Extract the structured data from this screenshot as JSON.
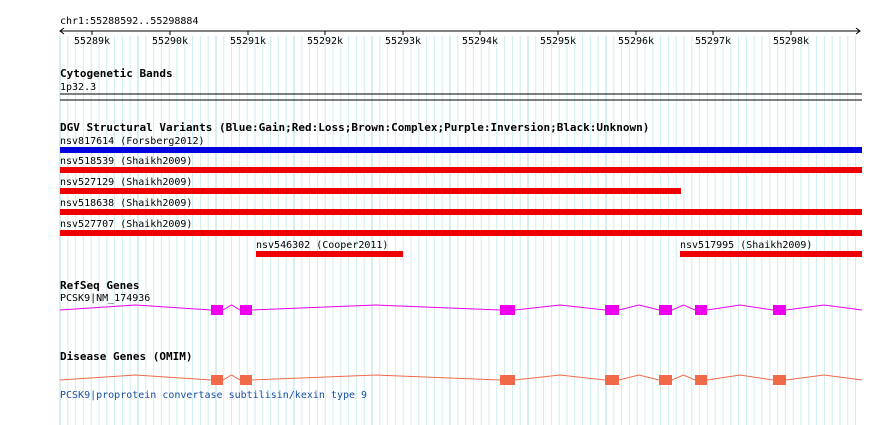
{
  "ruler": {
    "location": "chr1:55288592..55298884",
    "ticks": [
      "55289k",
      "55290k",
      "55291k",
      "55292k",
      "55293k",
      "55294k",
      "55295k",
      "55296k",
      "55297k",
      "55298k"
    ]
  },
  "cytoband": {
    "title": "Cytogenetic Bands",
    "label": "1p32.3"
  },
  "dgv": {
    "title": "DGV Structural Variants (Blue:Gain;Red:Loss;Brown:Complex;Purple:Inversion;Black:Unknown)",
    "variants": [
      {
        "label": "nsv817614 (Forsberg2012)",
        "color": "#0000e0"
      },
      {
        "label": "nsv518539 (Shaikh2009)",
        "color": "#ee0000"
      },
      {
        "label": "nsv527129 (Shaikh2009)",
        "color": "#ee0000"
      },
      {
        "label": "nsv518638 (Shaikh2009)",
        "color": "#ee0000"
      },
      {
        "label": "nsv527707 (Shaikh2009)",
        "color": "#ee0000"
      },
      {
        "label": "nsv546302 (Cooper2011)",
        "color": "#ee0000"
      },
      {
        "label": "nsv517995 (Shaikh2009)",
        "color": "#ee0000"
      }
    ]
  },
  "refseq": {
    "title": "RefSeq Genes",
    "gene_label": "PCSK9|NM_174936",
    "color": "#ee00ee"
  },
  "omim": {
    "title": "Disease Genes (OMIM)",
    "link": "PCSK9|proprotein convertase subtilisin/kexin type 9",
    "color": "#f06a4a"
  }
}
